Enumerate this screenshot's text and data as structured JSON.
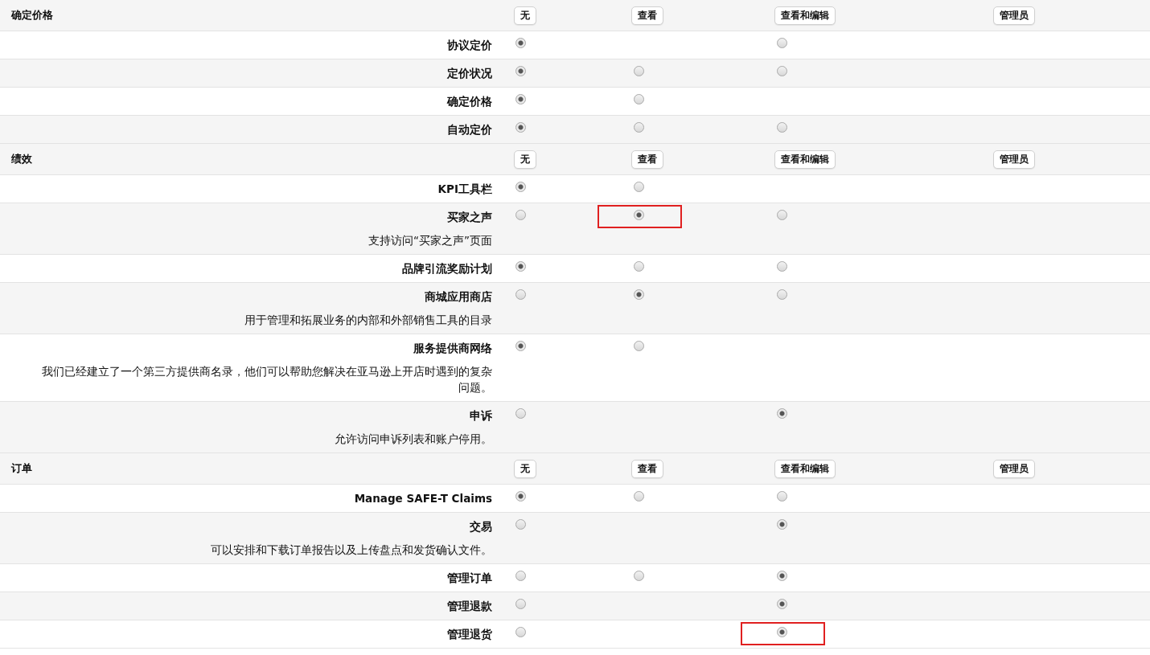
{
  "sections": [
    {
      "title": "确定价格",
      "levels": [
        "无",
        "查看",
        "查看和编辑",
        "管理员"
      ],
      "rows": [
        {
          "label": "协议定价",
          "options": [
            {
              "kind": "radio",
              "selected": true
            },
            {
              "kind": "empty"
            },
            {
              "kind": "radio",
              "selected": false
            }
          ]
        },
        {
          "label": "定价状况",
          "options": [
            {
              "kind": "radio",
              "selected": true
            },
            {
              "kind": "radio",
              "selected": false
            },
            {
              "kind": "radio",
              "selected": false
            }
          ]
        },
        {
          "label": "确定价格",
          "options": [
            {
              "kind": "radio",
              "selected": true
            },
            {
              "kind": "radio",
              "selected": false
            },
            {
              "kind": "empty"
            }
          ]
        },
        {
          "label": "自动定价",
          "options": [
            {
              "kind": "radio",
              "selected": true
            },
            {
              "kind": "radio",
              "selected": false
            },
            {
              "kind": "radio",
              "selected": false
            }
          ]
        }
      ]
    },
    {
      "title": "绩效",
      "levels": [
        "无",
        "查看",
        "查看和编辑",
        "管理员"
      ],
      "rows": [
        {
          "label": "KPI工具栏",
          "options": [
            {
              "kind": "radio",
              "selected": true
            },
            {
              "kind": "radio",
              "selected": false
            },
            {
              "kind": "empty"
            }
          ]
        },
        {
          "label": "买家之声",
          "description": "支持访问“买家之声”页面",
          "options": [
            {
              "kind": "radio",
              "selected": false
            },
            {
              "kind": "marked",
              "selected": true
            },
            {
              "kind": "radio",
              "selected": false
            }
          ]
        },
        {
          "label": "品牌引流奖励计划",
          "options": [
            {
              "kind": "radio",
              "selected": true
            },
            {
              "kind": "radio",
              "selected": false
            },
            {
              "kind": "radio",
              "selected": false
            }
          ]
        },
        {
          "label": "商城应用商店",
          "description": "用于管理和拓展业务的内部和外部销售工具的目录",
          "options": [
            {
              "kind": "radio",
              "selected": false
            },
            {
              "kind": "radio",
              "selected": true
            },
            {
              "kind": "radio",
              "selected": false
            }
          ]
        },
        {
          "label": "服务提供商网络",
          "description": "我们已经建立了一个第三方提供商名录，他们可以帮助您解决在亚马逊上开店时遇到的复杂问题。",
          "options": [
            {
              "kind": "radio",
              "selected": true
            },
            {
              "kind": "radio",
              "selected": false
            },
            {
              "kind": "empty"
            }
          ]
        },
        {
          "label": "申诉",
          "description": "允许访问申诉列表和账户停用。",
          "options": [
            {
              "kind": "radio",
              "selected": false
            },
            {
              "kind": "empty"
            },
            {
              "kind": "radio",
              "selected": true
            }
          ]
        }
      ]
    },
    {
      "title": "订单",
      "levels": [
        "无",
        "查看",
        "查看和编辑",
        "管理员"
      ],
      "rows": [
        {
          "label": "Manage SAFE-T Claims",
          "options": [
            {
              "kind": "radio",
              "selected": true
            },
            {
              "kind": "radio",
              "selected": false
            },
            {
              "kind": "radio",
              "selected": false
            }
          ]
        },
        {
          "label": "交易",
          "description": "可以安排和下载订单报告以及上传盘点和发货确认文件。",
          "options": [
            {
              "kind": "radio",
              "selected": false
            },
            {
              "kind": "empty"
            },
            {
              "kind": "radio",
              "selected": true
            }
          ]
        },
        {
          "label": "管理订单",
          "options": [
            {
              "kind": "radio",
              "selected": false
            },
            {
              "kind": "radio",
              "selected": false
            },
            {
              "kind": "radio",
              "selected": true
            }
          ]
        },
        {
          "label": "管理退款",
          "options": [
            {
              "kind": "radio",
              "selected": false
            },
            {
              "kind": "empty"
            },
            {
              "kind": "radio",
              "selected": true
            }
          ]
        },
        {
          "label": "管理退货",
          "options": [
            {
              "kind": "radio",
              "selected": false
            },
            {
              "kind": "empty"
            },
            {
              "kind": "marked",
              "selected": true
            }
          ]
        }
      ]
    }
  ]
}
